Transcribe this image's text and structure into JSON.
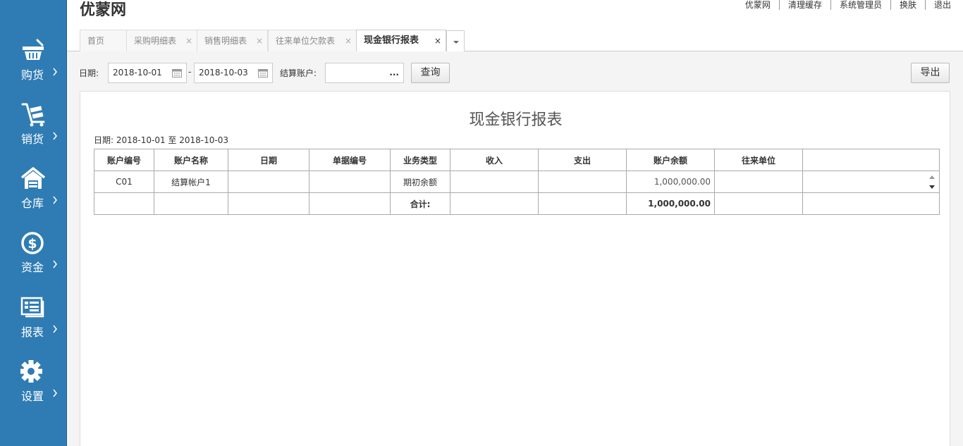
{
  "app": {
    "logo": "优蒙网"
  },
  "topnav": [
    "优蒙网",
    "清理缓存",
    "系统管理员",
    "换肤",
    "退出"
  ],
  "sidebar": {
    "items": [
      {
        "label": "购货",
        "icon": "basket-icon"
      },
      {
        "label": "销货",
        "icon": "cart-icon"
      },
      {
        "label": "仓库",
        "icon": "warehouse-icon"
      },
      {
        "label": "资金",
        "icon": "dollar-icon"
      },
      {
        "label": "报表",
        "icon": "report-icon"
      },
      {
        "label": "设置",
        "icon": "gear-icon"
      }
    ]
  },
  "tabs": [
    {
      "label": "首页",
      "closable": false,
      "active": false
    },
    {
      "label": "采购明细表",
      "closable": true,
      "active": false
    },
    {
      "label": "销售明细表",
      "closable": true,
      "active": false
    },
    {
      "label": "往来单位欠款表",
      "closable": true,
      "active": false
    },
    {
      "label": "现金银行报表",
      "closable": true,
      "active": true
    }
  ],
  "tab_close_glyph": "×",
  "filter": {
    "date_label": "日期:",
    "start_date": "2018-10-01",
    "separator": "-",
    "end_date": "2018-10-03",
    "account_label": "结算账户:",
    "account_value": "",
    "account_picker": "...",
    "query_button": "查询",
    "export_button": "导出"
  },
  "report": {
    "title": "现金银行报表",
    "date_range": "日期: 2018-10-01 至 2018-10-03",
    "columns": [
      "账户编号",
      "账户名称",
      "日期",
      "单据编号",
      "业务类型",
      "收入",
      "支出",
      "账户余额",
      "往来单位",
      ""
    ],
    "rows": [
      [
        "C01",
        "结算帐户1",
        "",
        "",
        "期初余额",
        "",
        "",
        "1,000,000.00",
        "",
        ""
      ]
    ],
    "totals": [
      "",
      "",
      "",
      "",
      "合计:",
      "",
      "",
      "1,000,000.00",
      "",
      ""
    ]
  }
}
